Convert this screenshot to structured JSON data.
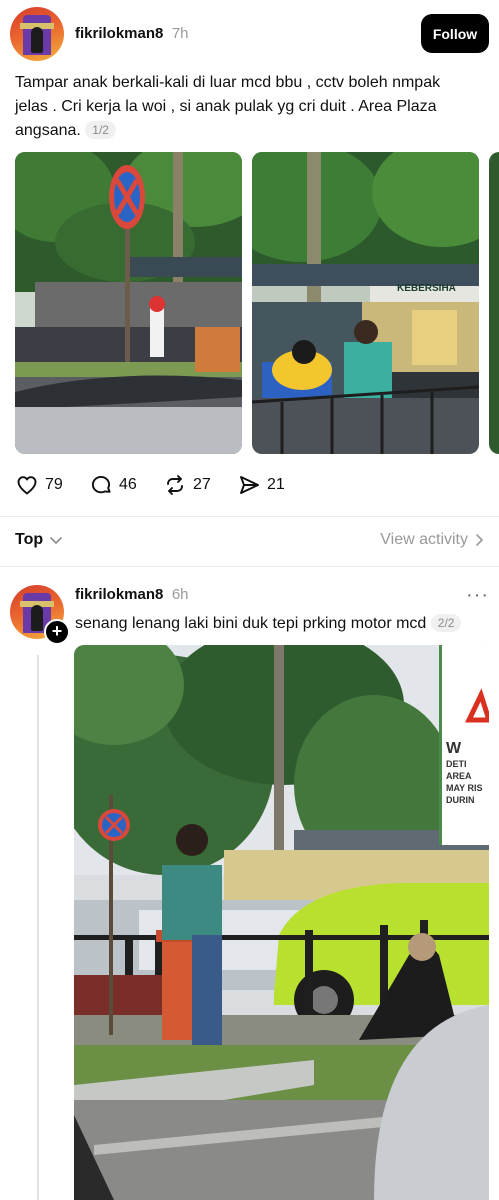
{
  "post1": {
    "username": "fikrilokman8",
    "time": "7h",
    "follow_label": "Follow",
    "text": "Tampar anak berkali-kali di luar mcd bbu , cctv boleh nmpak jelas . Cri kerja la woi , si anak pulak yg cri duit . Area Plaza angsana.",
    "counter": "1/2",
    "image2_sign": "KEBERSIHA",
    "actions": {
      "likes": "79",
      "comments": "46",
      "reposts": "27",
      "shares": "21"
    }
  },
  "sort_bar": {
    "label": "Top",
    "view_activity": "View activity"
  },
  "post2": {
    "username": "fikrilokman8",
    "time": "6h",
    "more": "···",
    "text": "senang lenang laki bini duk tepi prking motor mcd",
    "counter": "2/2",
    "sign_lines": [
      "W",
      "DETI",
      "AREA",
      "MAY RIS",
      "DURIN"
    ]
  },
  "icons": [
    "heart-icon",
    "comment-icon",
    "repost-icon",
    "share-icon",
    "chevron-down-icon",
    "chevron-right-icon",
    "more-icon",
    "plus-icon"
  ],
  "colors": {
    "follow_bg": "#000000",
    "muted": "#9a9a9a",
    "divider": "#ececec",
    "car": "#b7e02f"
  }
}
